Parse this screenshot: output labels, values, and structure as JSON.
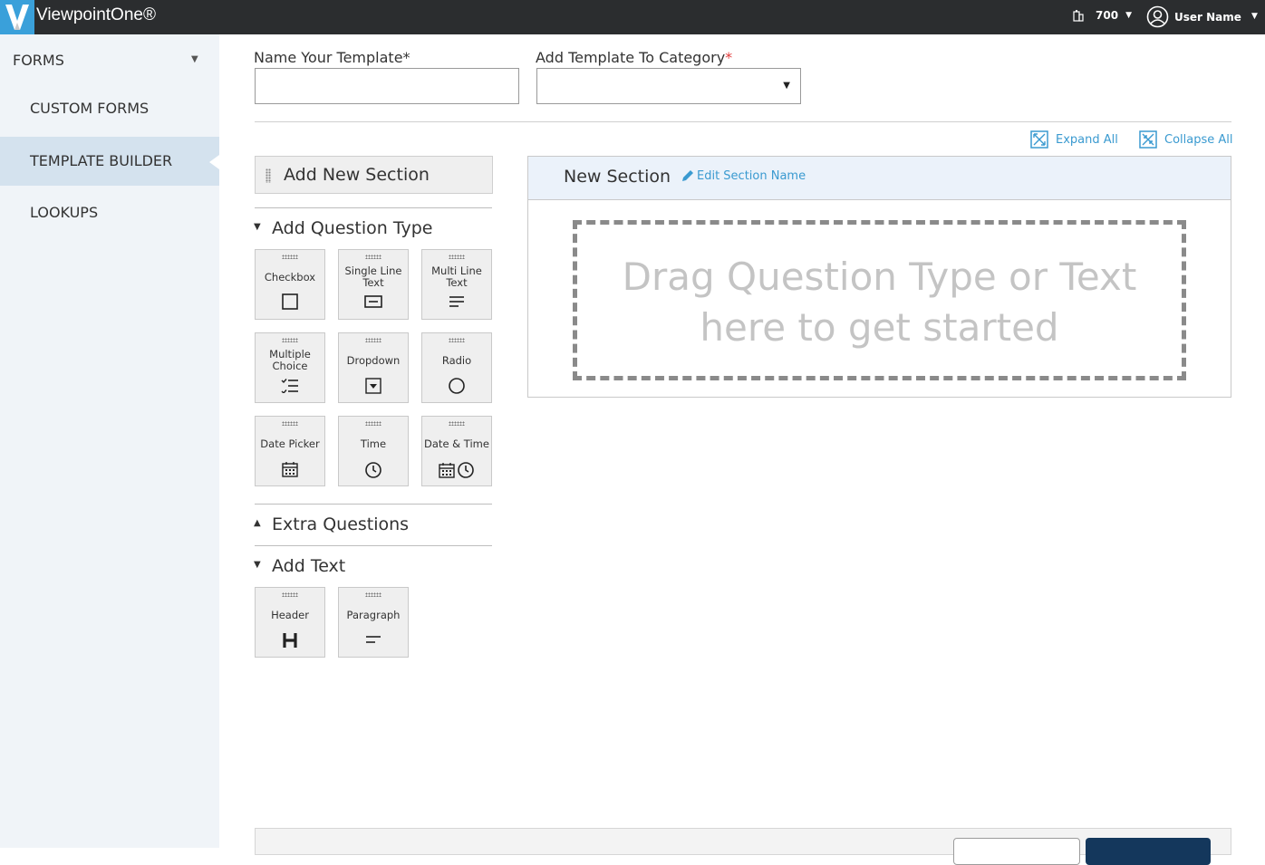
{
  "app": {
    "title": "ViewpointOne®"
  },
  "topbar": {
    "company_number": "700",
    "user_name": "User Name"
  },
  "sidebar": {
    "section_label": "FORMS",
    "items": [
      {
        "label": "CUSTOM FORMS",
        "active": false
      },
      {
        "label": "TEMPLATE BUILDER",
        "active": true
      },
      {
        "label": "LOOKUPS",
        "active": false
      }
    ]
  },
  "form": {
    "name_label": "Name Your Template*",
    "name_value": "",
    "category_label": "Add Template To Category",
    "category_required_mark": "*",
    "category_value": ""
  },
  "toolbar": {
    "expand_all": "Expand All",
    "collapse_all": "Collapse All"
  },
  "palette": {
    "add_section_label": "Add New Section",
    "question_group_label": "Add Question Type",
    "question_types": [
      {
        "label": "Checkbox",
        "icon": "checkbox-icon"
      },
      {
        "label": "Single Line Text",
        "icon": "single-line-text-icon"
      },
      {
        "label": "Multi Line Text",
        "icon": "multi-line-text-icon"
      },
      {
        "label": "Multiple Choice",
        "icon": "multiple-choice-icon"
      },
      {
        "label": "Dropdown",
        "icon": "dropdown-icon"
      },
      {
        "label": "Radio",
        "icon": "radio-icon"
      },
      {
        "label": "Date Picker",
        "icon": "calendar-icon"
      },
      {
        "label": "Time",
        "icon": "clock-icon"
      },
      {
        "label": "Date & Time",
        "icon": "calendar-clock-icon"
      }
    ],
    "extra_group_label": "Extra Questions",
    "text_group_label": "Add Text",
    "text_types": [
      {
        "label": "Header",
        "icon": "header-icon"
      },
      {
        "label": "Paragraph",
        "icon": "paragraph-icon"
      }
    ]
  },
  "section": {
    "title": "New Section",
    "edit_label": "Edit Section Name",
    "dropzone_text": "Drag Question Type or Text here to get started"
  },
  "colors": {
    "accent": "#3a9ad0",
    "topbar": "#2b2d2f",
    "logo": "#3aa0da",
    "active_nav": "#d4e2ee",
    "primary_button": "#14375c"
  }
}
